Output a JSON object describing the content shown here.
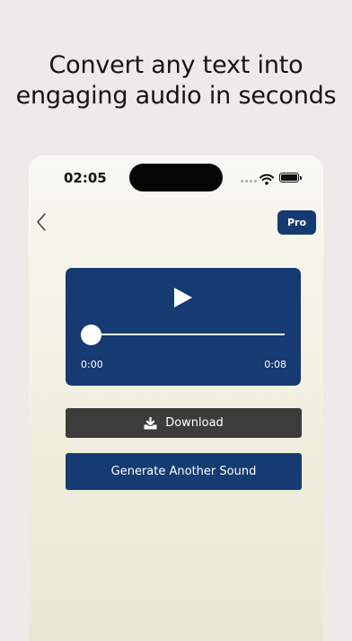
{
  "headline": {
    "line1": "Convert any text into",
    "line2": "engaging audio in seconds"
  },
  "status_bar": {
    "time": "02:05"
  },
  "nav": {
    "back_icon": "chevron-left-icon",
    "pro_label": "Pro"
  },
  "player": {
    "play_icon": "play-icon",
    "current_time": "0:00",
    "total_time": "0:08",
    "progress": 0
  },
  "actions": {
    "download_label": "Download",
    "download_icon": "download-tray-icon",
    "generate_label": "Generate Another Sound"
  },
  "colors": {
    "accent": "#163a72",
    "download_bg": "#3c3c3c",
    "page_bg": "#eeeae7"
  }
}
